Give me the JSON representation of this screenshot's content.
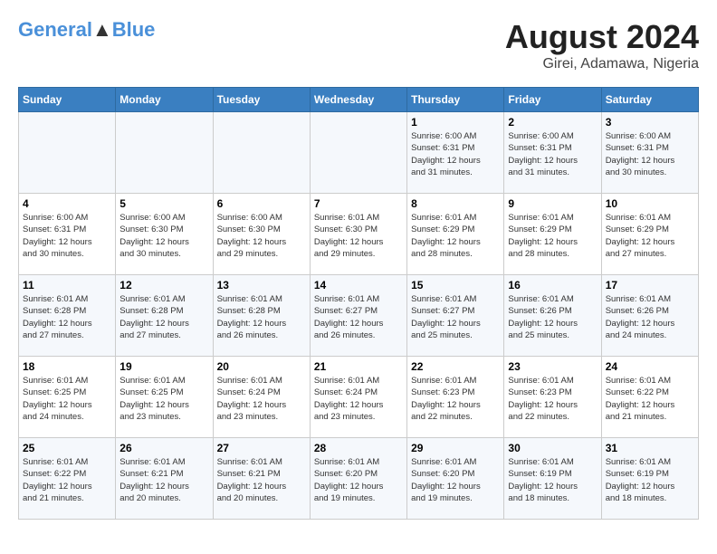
{
  "header": {
    "logo_line1_part1": "General",
    "logo_line1_part2": "Blue",
    "title": "August 2024",
    "subtitle": "Girei, Adamawa, Nigeria"
  },
  "days_of_week": [
    "Sunday",
    "Monday",
    "Tuesday",
    "Wednesday",
    "Thursday",
    "Friday",
    "Saturday"
  ],
  "weeks": [
    [
      {
        "day": "",
        "info": ""
      },
      {
        "day": "",
        "info": ""
      },
      {
        "day": "",
        "info": ""
      },
      {
        "day": "",
        "info": ""
      },
      {
        "day": "1",
        "info": "Sunrise: 6:00 AM\nSunset: 6:31 PM\nDaylight: 12 hours\nand 31 minutes."
      },
      {
        "day": "2",
        "info": "Sunrise: 6:00 AM\nSunset: 6:31 PM\nDaylight: 12 hours\nand 31 minutes."
      },
      {
        "day": "3",
        "info": "Sunrise: 6:00 AM\nSunset: 6:31 PM\nDaylight: 12 hours\nand 30 minutes."
      }
    ],
    [
      {
        "day": "4",
        "info": "Sunrise: 6:00 AM\nSunset: 6:31 PM\nDaylight: 12 hours\nand 30 minutes."
      },
      {
        "day": "5",
        "info": "Sunrise: 6:00 AM\nSunset: 6:30 PM\nDaylight: 12 hours\nand 30 minutes."
      },
      {
        "day": "6",
        "info": "Sunrise: 6:00 AM\nSunset: 6:30 PM\nDaylight: 12 hours\nand 29 minutes."
      },
      {
        "day": "7",
        "info": "Sunrise: 6:01 AM\nSunset: 6:30 PM\nDaylight: 12 hours\nand 29 minutes."
      },
      {
        "day": "8",
        "info": "Sunrise: 6:01 AM\nSunset: 6:29 PM\nDaylight: 12 hours\nand 28 minutes."
      },
      {
        "day": "9",
        "info": "Sunrise: 6:01 AM\nSunset: 6:29 PM\nDaylight: 12 hours\nand 28 minutes."
      },
      {
        "day": "10",
        "info": "Sunrise: 6:01 AM\nSunset: 6:29 PM\nDaylight: 12 hours\nand 27 minutes."
      }
    ],
    [
      {
        "day": "11",
        "info": "Sunrise: 6:01 AM\nSunset: 6:28 PM\nDaylight: 12 hours\nand 27 minutes."
      },
      {
        "day": "12",
        "info": "Sunrise: 6:01 AM\nSunset: 6:28 PM\nDaylight: 12 hours\nand 27 minutes."
      },
      {
        "day": "13",
        "info": "Sunrise: 6:01 AM\nSunset: 6:28 PM\nDaylight: 12 hours\nand 26 minutes."
      },
      {
        "day": "14",
        "info": "Sunrise: 6:01 AM\nSunset: 6:27 PM\nDaylight: 12 hours\nand 26 minutes."
      },
      {
        "day": "15",
        "info": "Sunrise: 6:01 AM\nSunset: 6:27 PM\nDaylight: 12 hours\nand 25 minutes."
      },
      {
        "day": "16",
        "info": "Sunrise: 6:01 AM\nSunset: 6:26 PM\nDaylight: 12 hours\nand 25 minutes."
      },
      {
        "day": "17",
        "info": "Sunrise: 6:01 AM\nSunset: 6:26 PM\nDaylight: 12 hours\nand 24 minutes."
      }
    ],
    [
      {
        "day": "18",
        "info": "Sunrise: 6:01 AM\nSunset: 6:25 PM\nDaylight: 12 hours\nand 24 minutes."
      },
      {
        "day": "19",
        "info": "Sunrise: 6:01 AM\nSunset: 6:25 PM\nDaylight: 12 hours\nand 23 minutes."
      },
      {
        "day": "20",
        "info": "Sunrise: 6:01 AM\nSunset: 6:24 PM\nDaylight: 12 hours\nand 23 minutes."
      },
      {
        "day": "21",
        "info": "Sunrise: 6:01 AM\nSunset: 6:24 PM\nDaylight: 12 hours\nand 23 minutes."
      },
      {
        "day": "22",
        "info": "Sunrise: 6:01 AM\nSunset: 6:23 PM\nDaylight: 12 hours\nand 22 minutes."
      },
      {
        "day": "23",
        "info": "Sunrise: 6:01 AM\nSunset: 6:23 PM\nDaylight: 12 hours\nand 22 minutes."
      },
      {
        "day": "24",
        "info": "Sunrise: 6:01 AM\nSunset: 6:22 PM\nDaylight: 12 hours\nand 21 minutes."
      }
    ],
    [
      {
        "day": "25",
        "info": "Sunrise: 6:01 AM\nSunset: 6:22 PM\nDaylight: 12 hours\nand 21 minutes."
      },
      {
        "day": "26",
        "info": "Sunrise: 6:01 AM\nSunset: 6:21 PM\nDaylight: 12 hours\nand 20 minutes."
      },
      {
        "day": "27",
        "info": "Sunrise: 6:01 AM\nSunset: 6:21 PM\nDaylight: 12 hours\nand 20 minutes."
      },
      {
        "day": "28",
        "info": "Sunrise: 6:01 AM\nSunset: 6:20 PM\nDaylight: 12 hours\nand 19 minutes."
      },
      {
        "day": "29",
        "info": "Sunrise: 6:01 AM\nSunset: 6:20 PM\nDaylight: 12 hours\nand 19 minutes."
      },
      {
        "day": "30",
        "info": "Sunrise: 6:01 AM\nSunset: 6:19 PM\nDaylight: 12 hours\nand 18 minutes."
      },
      {
        "day": "31",
        "info": "Sunrise: 6:01 AM\nSunset: 6:19 PM\nDaylight: 12 hours\nand 18 minutes."
      }
    ]
  ]
}
